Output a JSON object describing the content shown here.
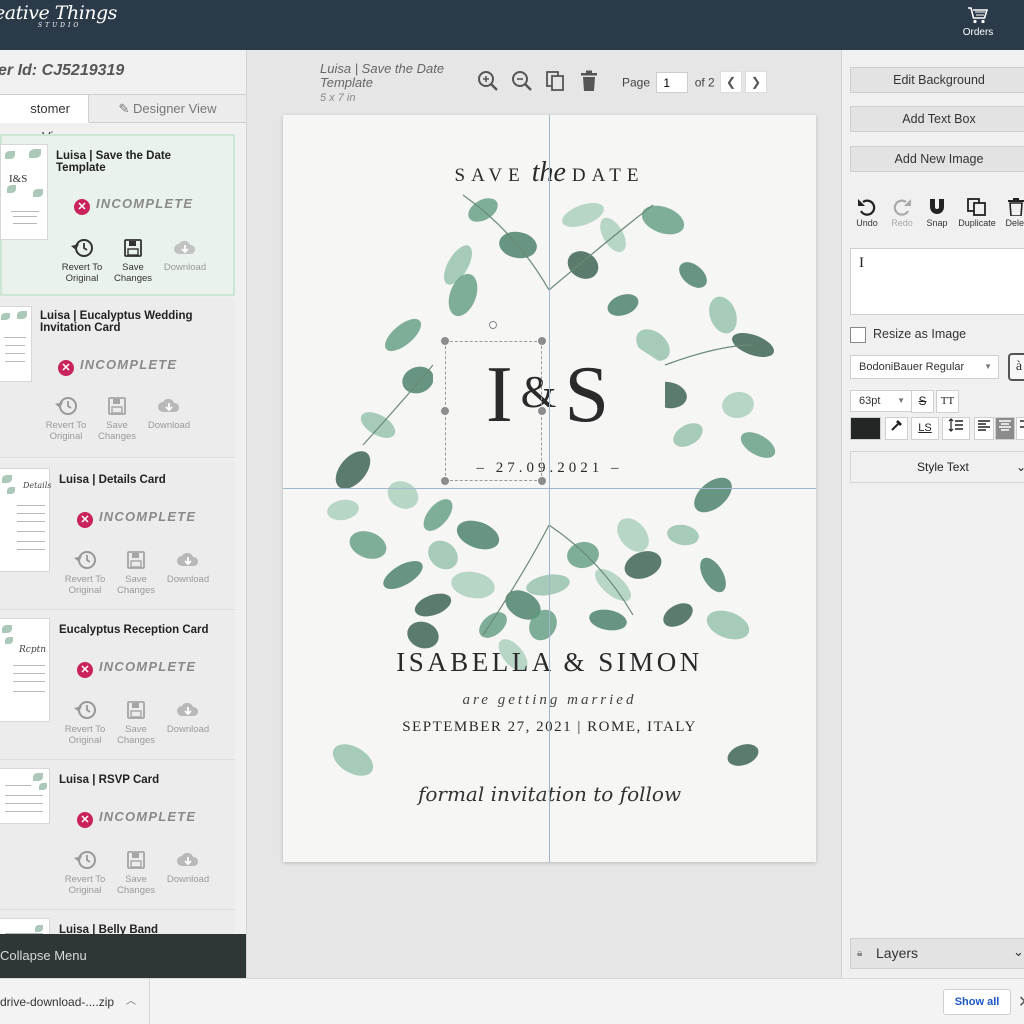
{
  "app": {
    "logo_line1": "eative Things",
    "logo_line2": "STUDIO",
    "orders_label": "Orders",
    "icons": {
      "orders": "cart-icon"
    }
  },
  "left_panel": {
    "order_id": "er Id: CJ5219319",
    "tabs": [
      {
        "label": "stomer View",
        "active": true
      },
      {
        "label": "Designer View",
        "active": false,
        "icon": "pencil-icon"
      }
    ],
    "cards": [
      {
        "title": "Luisa | Save the Date Template",
        "status": "INCOMPLETE",
        "selected": true,
        "actions": [
          "Revert To Original",
          "Save Changes",
          "Download"
        ]
      },
      {
        "title": "Luisa | Eucalyptus Wedding Invitation Card",
        "status": "INCOMPLETE",
        "selected": false,
        "actions": [
          "Revert To Original",
          "Save Changes",
          "Download"
        ]
      },
      {
        "title": "Luisa | Details Card",
        "status": "INCOMPLETE",
        "selected": false,
        "actions": [
          "Revert To Original",
          "Save Changes",
          "Download"
        ]
      },
      {
        "title": "Eucalyptus Reception Card",
        "status": "INCOMPLETE",
        "selected": false,
        "actions": [
          "Revert To Original",
          "Save Changes",
          "Download"
        ]
      },
      {
        "title": "Luisa | RSVP Card",
        "status": "INCOMPLETE",
        "selected": false,
        "actions": [
          "Revert To Original",
          "Save Changes",
          "Download"
        ]
      },
      {
        "title": "Luisa | Belly Band",
        "status": "",
        "selected": false,
        "actions": []
      }
    ],
    "status_color": "#c8235c",
    "collapse_label": "Collapse Menu"
  },
  "editor": {
    "doc_title": "Luisa | Save the Date Template",
    "doc_size": "5 x 7 in",
    "toolbar_icons": [
      "zoom-in-icon",
      "zoom-out-icon",
      "copy-icon",
      "trash-icon"
    ],
    "page_label": "Page",
    "page_value": "1",
    "page_total": "of 2"
  },
  "card_design": {
    "save_the_date": "SAVE",
    "the": "the",
    "date": "DATE",
    "initial_1": "I",
    "ampersand": "&",
    "initial_2": "S",
    "date_short": "– 27.09.2021 –",
    "names": "ISABELLA & SIMON",
    "are_getting_married": "are getting married",
    "date_long": "SEPTEMBER 27, 2021 | ROME, ITALY",
    "formal_invitation": "formal invitation to follow",
    "leaf_colors": [
      "#5e9a7e",
      "#3f7a60",
      "#8fbfa6",
      "#2f5a47",
      "#a7cdb9"
    ]
  },
  "right_panel": {
    "buttons": [
      "Edit Background",
      "Add Text Box",
      "Add New Image"
    ],
    "tools": [
      {
        "label": "Undo",
        "icon": "undo-icon",
        "enabled": true
      },
      {
        "label": "Redo",
        "icon": "redo-icon",
        "enabled": false
      },
      {
        "label": "Snap",
        "icon": "magnet-icon",
        "enabled": true
      },
      {
        "label": "Duplicate",
        "icon": "duplicate-icon",
        "enabled": true
      },
      {
        "label": "Delet",
        "icon": "trash-icon",
        "enabled": true
      }
    ],
    "text_value": "I",
    "resize_as_image": "Resize as Image",
    "font": "BodoniBauer Regular",
    "font_preview": "à",
    "font_size": "63pt",
    "text_color": "#222726",
    "format_buttons": [
      "S",
      "TT",
      "LS"
    ],
    "style_text": "Style Text",
    "layers": "Layers"
  },
  "download_bar": {
    "file_name": "drive-download-....zip",
    "show_all": "Show all"
  }
}
